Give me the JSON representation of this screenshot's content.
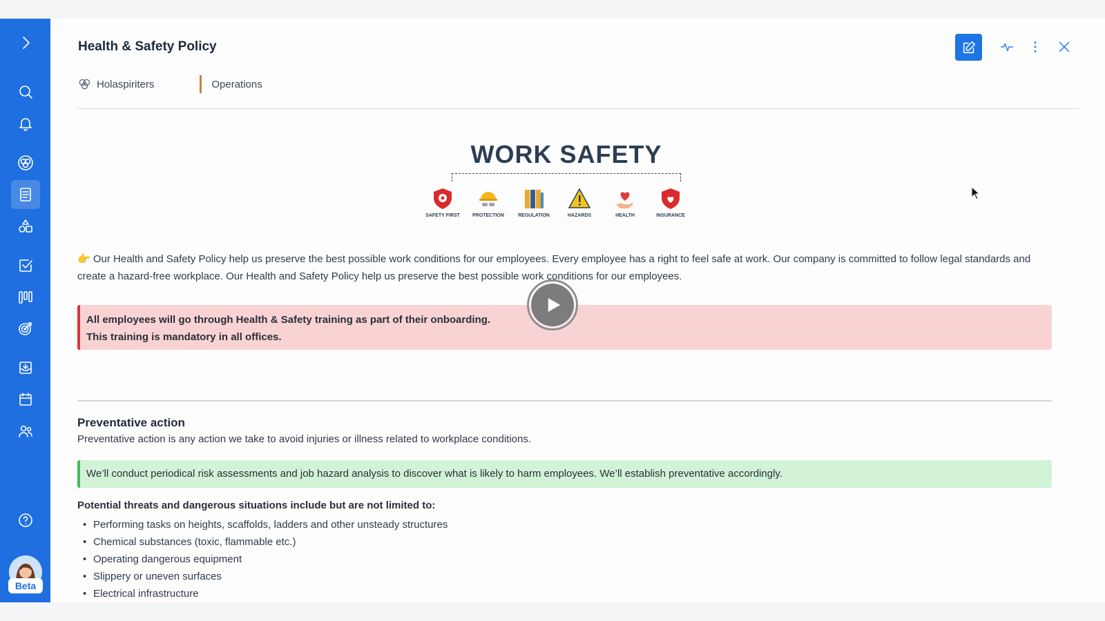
{
  "header": {
    "title": "Health & Safety Policy"
  },
  "tags": {
    "group": "Holaspiriters",
    "category": "Operations"
  },
  "banner": {
    "title": "WORK SAFETY",
    "labels": [
      "SAFETY FIRST",
      "PROTECTION",
      "REGULATION",
      "HAZARDS",
      "HEALTH",
      "INSURANCE"
    ]
  },
  "intro": {
    "emoji": "👉",
    "text": "Our Health and Safety Policy help us preserve the best possible work conditions for our employees. Every employee has a right to feel safe at work. Our company is committed to follow legal standards and create a hazard-free workplace. Our Health and Safety Policy help us preserve the best possible work conditions for our employees."
  },
  "alert": {
    "line1": "All employees will go through Health & Safety training as part of their onboarding.",
    "line2": "This training is mandatory in all offices."
  },
  "section": {
    "heading": "Preventative action",
    "paragraph": "Preventative action is any action we take to avoid injuries or illness related to workplace conditions.",
    "callout": "We’ll conduct periodical risk assessments and job hazard analysis to discover what is likely to harm employees. We’ll establish preventative accordingly.",
    "threats_heading": "Potential threats and dangerous situations include but are not limited to:",
    "threats": [
      "Performing tasks on heights, scaffolds, ladders and other unsteady structures",
      "Chemical substances (toxic, flammable etc.)",
      "Operating dangerous equipment",
      "Slippery or uneven surfaces",
      "Electrical infrastructure"
    ]
  },
  "sidebar": {
    "beta_label": "Beta",
    "icons": [
      "chevron-right-icon",
      "search-icon",
      "bell-icon",
      "circles-icon",
      "document-icon",
      "shapes-icon",
      "checkbox-icon",
      "kanban-icon",
      "target-icon",
      "inbox-icon",
      "calendar-icon",
      "people-icon",
      "help-icon"
    ]
  },
  "colors": {
    "sidebar": "#1f6fe0",
    "alert_red_bg": "#f9d3d3",
    "alert_red_border": "#d9353b",
    "alert_green_bg": "#d2f3d7",
    "alert_green_border": "#3cc057",
    "tag_bar": "#c8833c"
  }
}
